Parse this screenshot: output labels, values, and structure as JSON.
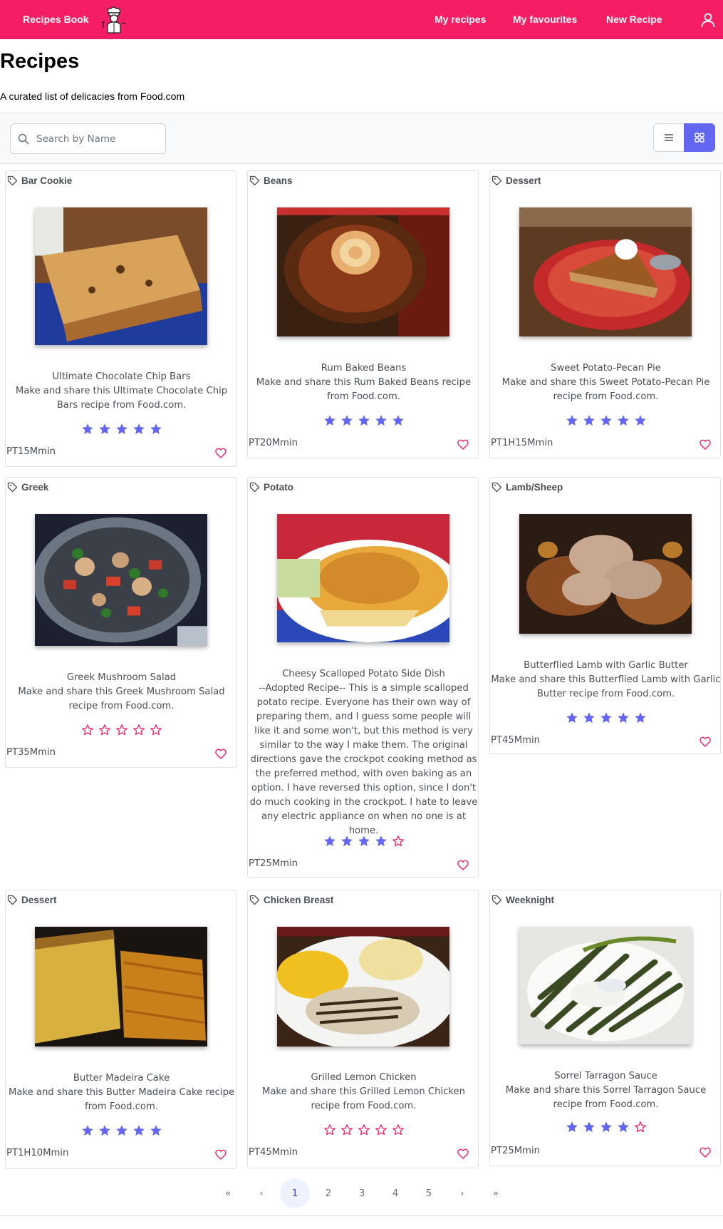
{
  "header": {
    "brand": "Recipes Book",
    "nav": [
      "My recipes",
      "My favourites",
      "New Recipe"
    ]
  },
  "page": {
    "title": "Recipes",
    "subtitle": "A curated list of delicacies from Food.com"
  },
  "search": {
    "placeholder": "Search by Name",
    "value": ""
  },
  "view_mode": "grid",
  "colors": {
    "brand": "#f51d63",
    "accent": "#6366f1",
    "star_empty": "#f51d63",
    "heart": "#f51d63"
  },
  "recipes": [
    {
      "category": "Bar Cookie",
      "title": "Ultimate Chocolate Chip Bars",
      "description": "Make and share this Ultimate Chocolate Chip Bars recipe from Food.com.",
      "rating": 5,
      "time": "PT15Mmin",
      "favourite": false
    },
    {
      "category": "Beans",
      "title": "Rum Baked Beans",
      "description": "Make and share this Rum Baked Beans recipe from Food.com.",
      "rating": 5,
      "time": "PT20Mmin",
      "favourite": false
    },
    {
      "category": "Dessert",
      "title": "Sweet Potato-Pecan Pie",
      "description": "Make and share this Sweet Potato-Pecan Pie recipe from Food.com.",
      "rating": 5,
      "time": "PT1H15Mmin",
      "favourite": false
    },
    {
      "category": "Greek",
      "title": "Greek Mushroom Salad",
      "description": "Make and share this Greek Mushroom Salad recipe from Food.com.",
      "rating": 0,
      "time": "PT35Mmin",
      "favourite": false
    },
    {
      "category": "Potato",
      "title": "Cheesy Scalloped Potato Side Dish",
      "description": "--Adopted Recipe-- This is a simple scalloped potato recipe. Everyone has their own way of preparing them, and I guess some people will like it and some won't, but this method is very similar to the way I make them. The original directions gave the crockpot cooking method as the preferred method, with oven baking as an option. I have reversed this option, since I don't do much cooking in the crockpot. I hate to leave any electric appliance on when no one is at home.",
      "rating": 4,
      "time": "PT25Mmin",
      "favourite": false
    },
    {
      "category": "Lamb/Sheep",
      "title": "Butterflied Lamb with Garlic Butter",
      "description": "Make and share this Butterflied Lamb with Garlic Butter recipe from Food.com.",
      "rating": 5,
      "time": "PT45Mmin",
      "favourite": false
    },
    {
      "category": "Dessert",
      "title": "Butter Madeira Cake",
      "description": "Make and share this Butter Madeira Cake recipe from Food.com.",
      "rating": 5,
      "time": "PT1H10Mmin",
      "favourite": false
    },
    {
      "category": "Chicken Breast",
      "title": "Grilled Lemon Chicken",
      "description": "Make and share this Grilled Lemon Chicken recipe from Food.com.",
      "rating": 0,
      "time": "PT45Mmin",
      "favourite": false
    },
    {
      "category": "Weeknight",
      "title": "Sorrel Tarragon Sauce",
      "description": "Make and share this Sorrel Tarragon Sauce recipe from Food.com.",
      "rating": 4,
      "time": "PT25Mmin",
      "favourite": false
    }
  ],
  "pagination": {
    "first": "«",
    "prev": "‹",
    "pages": [
      "1",
      "2",
      "3",
      "4",
      "5"
    ],
    "current": "1",
    "next": "›",
    "last": "»"
  }
}
